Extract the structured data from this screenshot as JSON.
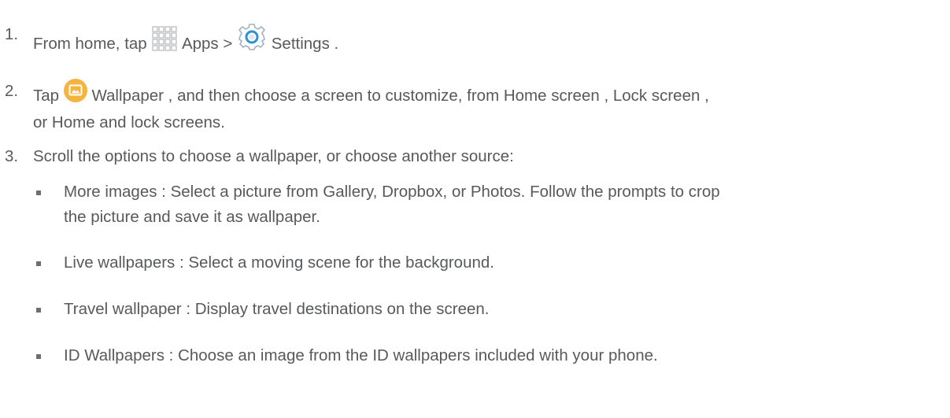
{
  "steps": [
    {
      "number": "1.",
      "parts": {
        "pre": "From home, tap ",
        "apps_icon": "apps-grid-icon",
        "apps_label": " Apps",
        "sep": " > ",
        "settings_icon": "settings-gear-icon",
        "settings_label": " Settings",
        "post": " ."
      }
    },
    {
      "number": "2.",
      "parts": {
        "pre": "Tap ",
        "wallpaper_icon": "wallpaper-image-icon",
        "wallpaper_label": " Wallpaper",
        "post": " , and then choose a screen to customize, from Home screen , Lock screen ,",
        "line2": "or Home and lock screens."
      }
    },
    {
      "number": "3.",
      "text": "Scroll the options to choose a wallpaper, or choose another source:"
    }
  ],
  "bullets": [
    {
      "line1": "More images : Select a picture from Gallery, Dropbox, or Photos. Follow the prompts to crop",
      "line2": "the picture and save it as wallpaper."
    },
    {
      "line1": "Live wallpapers  : Select a moving scene for the background."
    },
    {
      "line1": "Travel wallpaper  : Display travel destinations on the screen."
    },
    {
      "line1": "ID Wallpapers : Choose an image from the ID wallpapers included with your phone."
    }
  ],
  "colors": {
    "text": "#58595b",
    "bullet": "#6d6e71",
    "wallpaper_icon_bg": "#f4b43f",
    "settings_icon_blue": "#2f8fd0"
  }
}
